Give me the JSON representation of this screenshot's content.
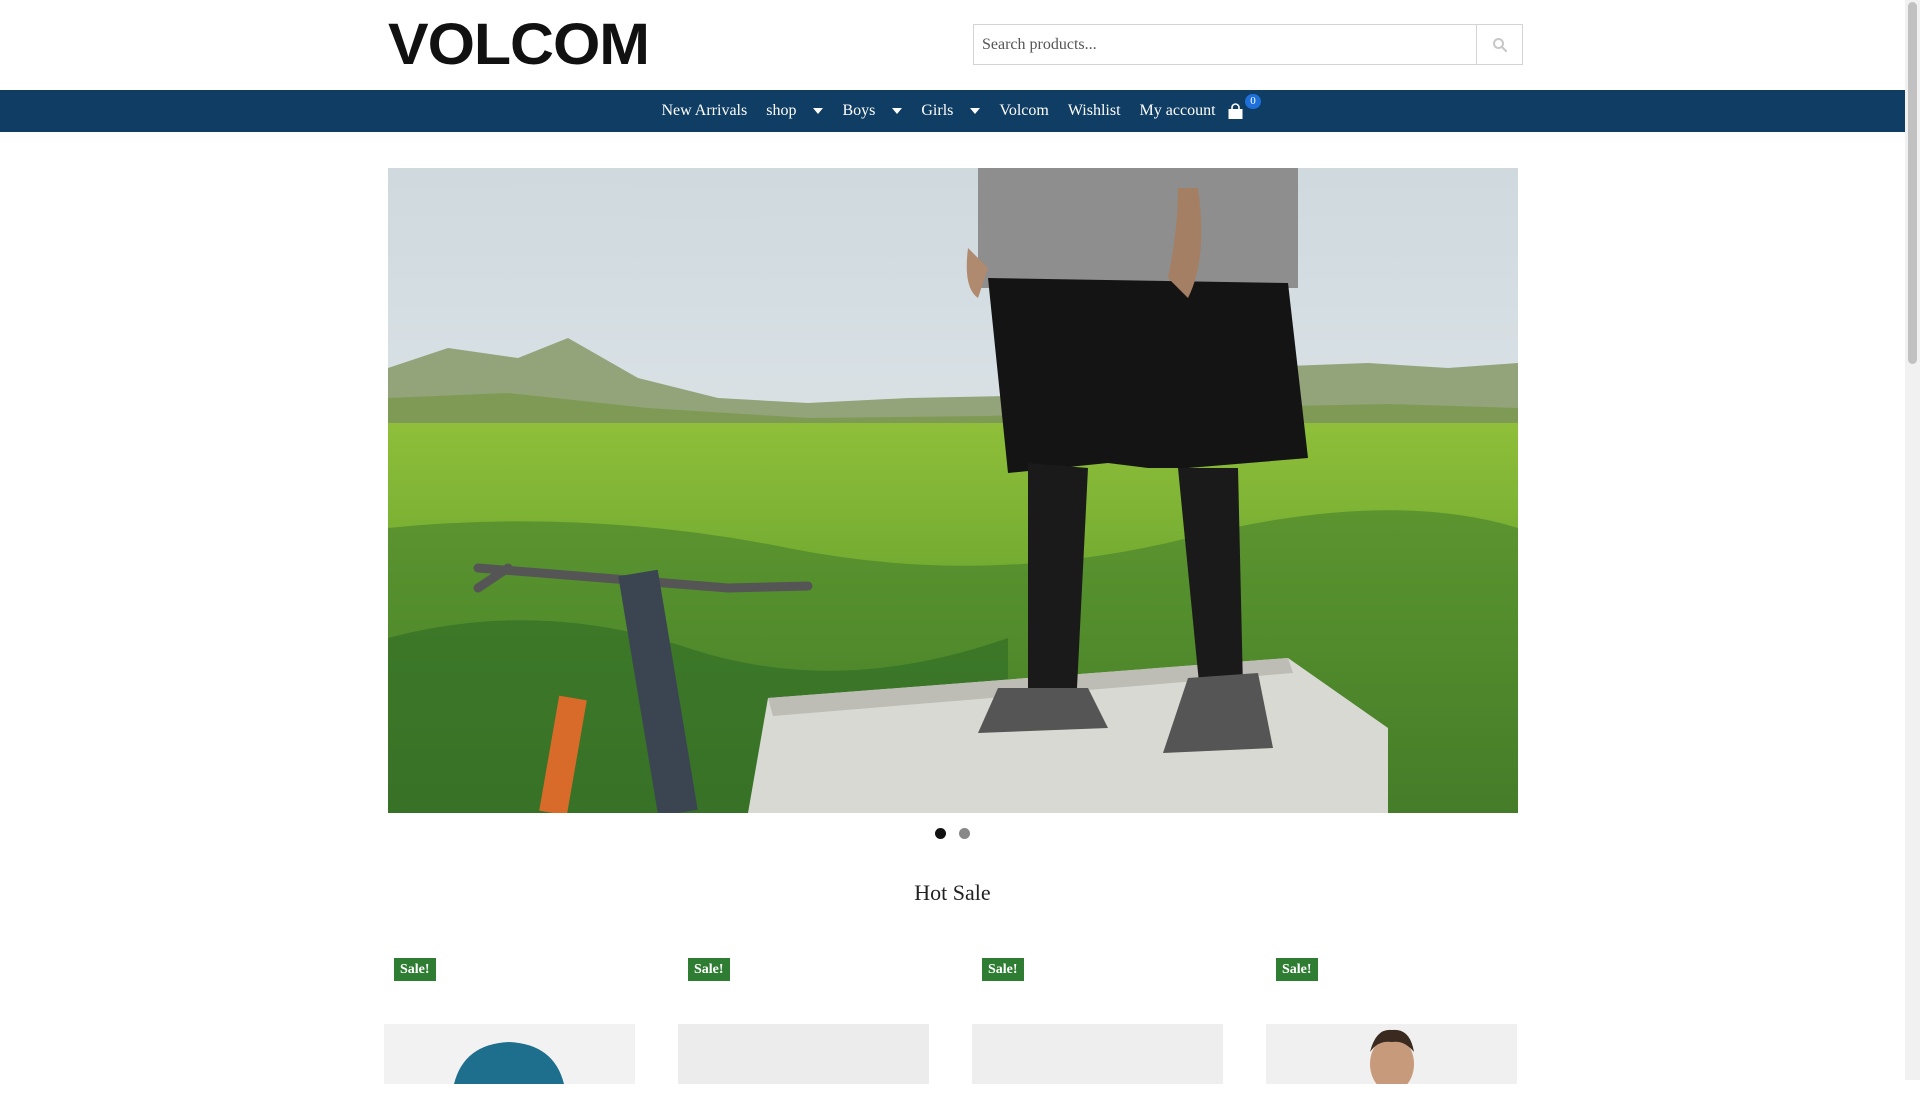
{
  "header": {
    "logo_text": "VOLCOM",
    "search": {
      "placeholder": "Search products..."
    }
  },
  "nav": {
    "items": [
      {
        "label": "New Arrivals",
        "dropdown": false
      },
      {
        "label": "shop",
        "dropdown": true
      },
      {
        "label": "Boys",
        "dropdown": true
      },
      {
        "label": "Girls",
        "dropdown": true
      },
      {
        "label": "Volcom",
        "dropdown": false
      },
      {
        "label": "Wishlist",
        "dropdown": false
      },
      {
        "label": "My account",
        "dropdown": false
      }
    ],
    "cart_count": "0"
  },
  "slider": {
    "slides": 2,
    "active_slide": 1
  },
  "section": {
    "title": "Hot Sale"
  },
  "products": [
    {
      "badge": "Sale!"
    },
    {
      "badge": "Sale!"
    },
    {
      "badge": "Sale!"
    },
    {
      "badge": "Sale!"
    }
  ],
  "colors": {
    "nav_bg": "#0f3d63",
    "sale_badge": "#2e7d32",
    "cart_badge": "#1e6fd9"
  }
}
